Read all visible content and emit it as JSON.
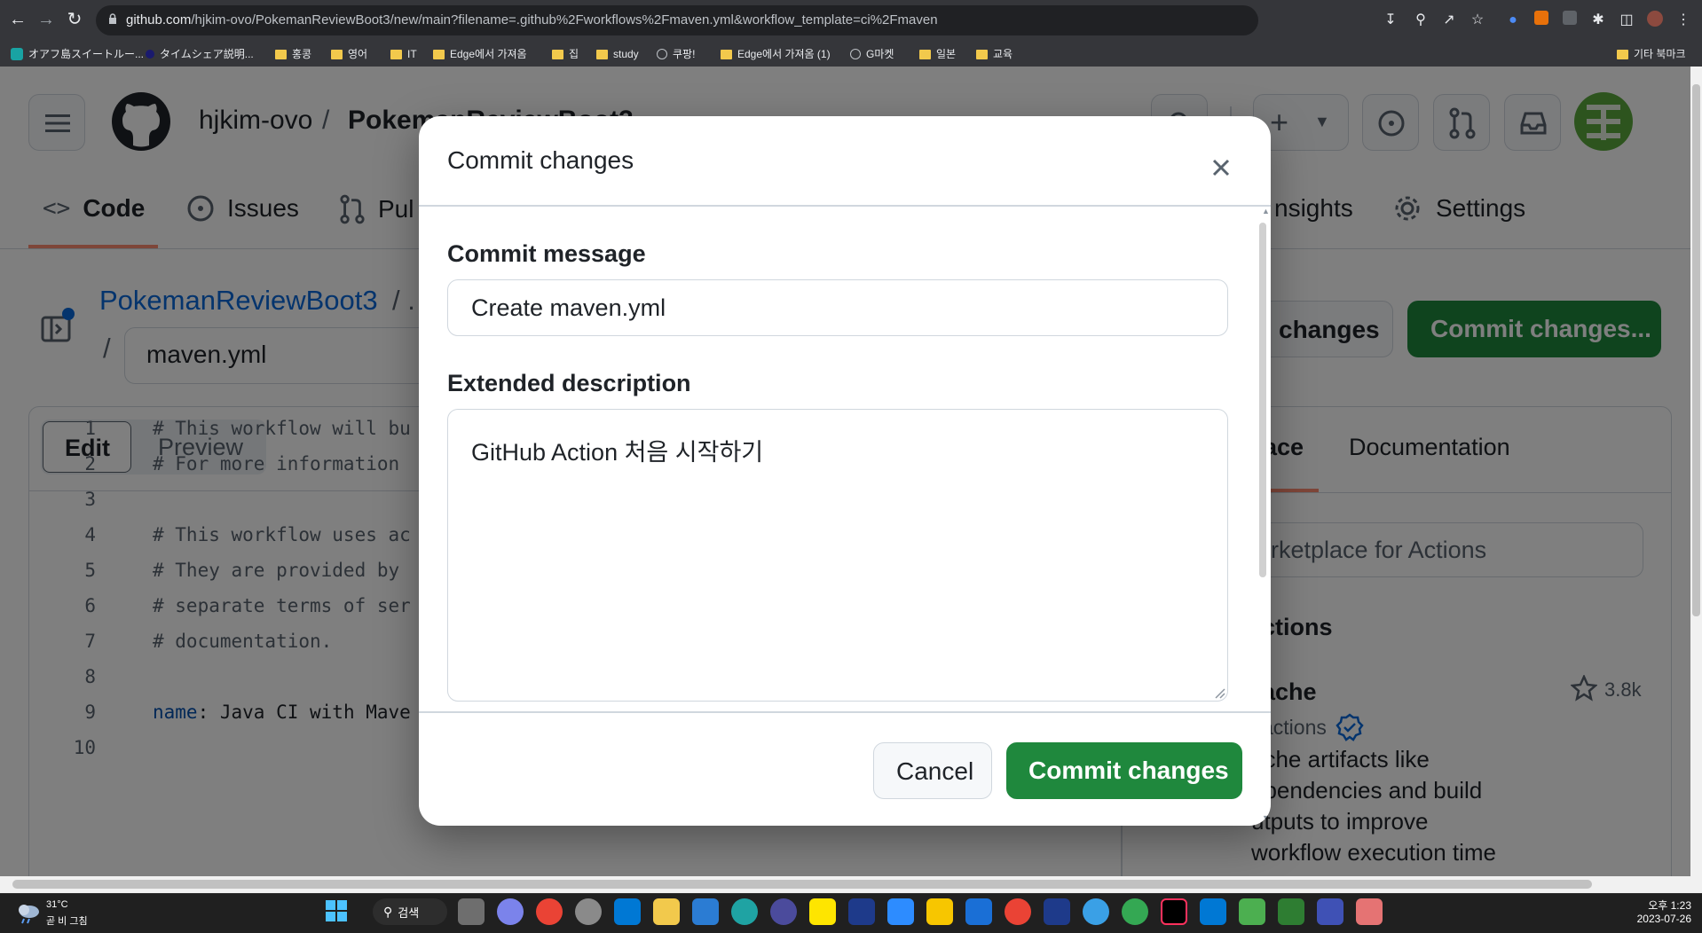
{
  "browser": {
    "url_host": "github.com",
    "url_path": "/hjkim-ovo/PokemanReviewBoot3/new/main?filename=.github%2Fworkflows%2Fmaven.yml&workflow_template=ci%2Fmaven",
    "bookmarks": [
      "オアフ島スイートルー...",
      "タイムシェア説明...",
      "홍콩",
      "영어",
      "IT",
      "Edge에서 가져옴",
      "집",
      "study",
      "쿠팡!",
      "Edge에서 가져옴 (1)",
      "G마켓",
      "일본",
      "교육"
    ],
    "other_bookmarks": "기타 북마크"
  },
  "github": {
    "owner": "hjkim-ovo",
    "separator": "/",
    "repo_partial": "Pokem",
    "repo_tail": "anReviewBoot3",
    "tabs": {
      "code": "Code",
      "issues": "Issues",
      "pulls": "Pul",
      "insights": "nsights",
      "settings": "Settings"
    },
    "breadcrumb_repo": "PokemanReviewBoot3",
    "breadcrumb_sep": "/ .",
    "filename": "maven.yml",
    "cancel_changes": "changes",
    "commit_changes_header": "Commit changes...",
    "editor_tabs": {
      "edit": "Edit",
      "preview": "Preview"
    },
    "side_tabs": {
      "marketplace": "ace",
      "documentation": "Documentation"
    },
    "marketplace_search_placeholder": "arketplace for Actions",
    "actions_heading": "ctions",
    "action_card": {
      "name": "ache",
      "publisher": "actions",
      "stars": "3.8k",
      "desc_lines": [
        "ache artifacts like",
        "ependencies and build",
        "utputs to improve",
        "workflow execution time"
      ]
    },
    "code_lines": [
      {
        "n": "1",
        "text": "# This workflow will bu"
      },
      {
        "n": "2",
        "text": "# For more information"
      },
      {
        "n": "3",
        "text": ""
      },
      {
        "n": "4",
        "text": "# This workflow uses ac"
      },
      {
        "n": "5",
        "text": "# They are provided by"
      },
      {
        "n": "6",
        "text": "# separate terms of ser"
      },
      {
        "n": "7",
        "text": "# documentation."
      },
      {
        "n": "8",
        "text": ""
      },
      {
        "n": "9",
        "key": "name",
        "rest": ": Java CI with Mave"
      },
      {
        "n": "10",
        "text": ""
      }
    ]
  },
  "modal": {
    "title": "Commit changes",
    "commit_message_label": "Commit message",
    "commit_message_value": "Create maven.yml",
    "extended_label": "Extended description",
    "extended_value": "GitHub Action 처음 시작하기",
    "cancel": "Cancel",
    "commit": "Commit changes"
  },
  "taskbar": {
    "weather_temp": "31°C",
    "weather_desc": "곧 비 그침",
    "search": "검색",
    "time": "오후 1:23",
    "date": "2023-07-26"
  },
  "colors": {
    "primary_green": "#1f883d",
    "accent_blue": "#0969da",
    "tab_underline": "#fd8c73"
  }
}
